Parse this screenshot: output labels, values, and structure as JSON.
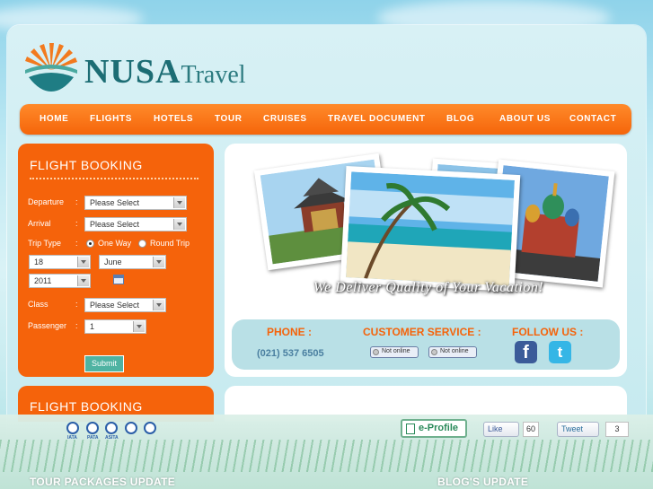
{
  "brand": {
    "name": "NUSA",
    "sub": "Travel"
  },
  "nav": [
    "HOME",
    "FLIGHTS",
    "HOTELS",
    "TOUR",
    "CRUISES",
    "TRAVEL DOCUMENT",
    "BLOG",
    "ABOUT US",
    "CONTACT"
  ],
  "booking": {
    "title": "FLIGHT BOOKING",
    "departure_label": "Departure",
    "arrival_label": "Arrival",
    "trip_type_label": "Trip Type",
    "class_label": "Class",
    "passenger_label": "Passenger",
    "departure_value": "Please Select",
    "arrival_value": "Please Select",
    "one_way": "One Way",
    "round_trip": "Round Trip",
    "day": "18",
    "month": "June",
    "year": "2011",
    "class_value": "Please Select",
    "passenger_value": "1",
    "submit": "Submit"
  },
  "booking2": {
    "title": "FLIGHT BOOKING"
  },
  "hero": {
    "tagline": "We Deliver Quality of Your Vacation!"
  },
  "contact": {
    "phone_label": "PHONE :",
    "phone": "(021) 537 6505",
    "cs_label": "CUSTOMER SERVICE :",
    "status_1": "Not online",
    "status_2": "Not online",
    "follow_label": "FOLLOW US :",
    "fb_glyph": "f",
    "tw_glyph": "t"
  },
  "footer": {
    "assoc_labels": [
      "IATA",
      "PATA",
      "ASITA",
      "",
      ""
    ],
    "eprofile": "e-Profile",
    "like": "Like",
    "like_count": "60",
    "tweet": "Tweet",
    "tweet_count": "3",
    "tour_updates": "TOUR PACKAGES UPDATE",
    "blog_updates": "BLOG'S UPDATE"
  },
  "colors": {
    "orange": "#f5630b",
    "teal": "#1c6d74",
    "contact_bg": "#b9e0e6"
  }
}
